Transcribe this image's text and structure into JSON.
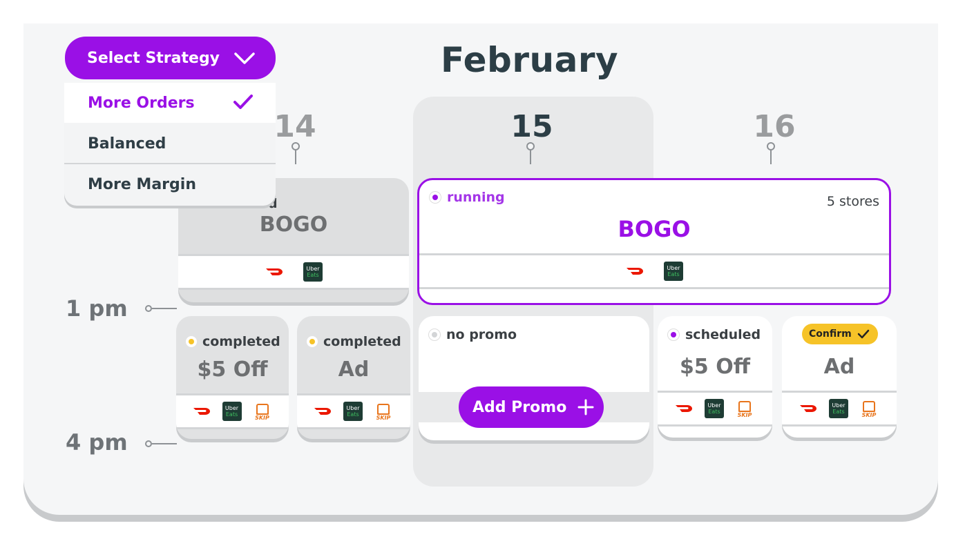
{
  "header": {
    "month": "February"
  },
  "days": [
    "14",
    "15",
    "16"
  ],
  "times": [
    "1 pm",
    "4 pm"
  ],
  "strategy": {
    "button_label": "Select Strategy",
    "options": [
      {
        "label": "More Orders",
        "selected": true
      },
      {
        "label": "Balanced",
        "selected": false
      },
      {
        "label": "More Margin",
        "selected": false
      }
    ]
  },
  "cards": {
    "d14_top": {
      "status_visible": "d",
      "name": "BOGO"
    },
    "d15_top": {
      "status": "running",
      "stores": "5 stores",
      "name": "BOGO"
    },
    "d14_a": {
      "status": "completed",
      "name": "$5 Off"
    },
    "d14_b": {
      "status": "completed",
      "name": "Ad"
    },
    "d15_mid": {
      "status": "no promo",
      "add_label": "Add Promo"
    },
    "d16_a": {
      "status": "scheduled",
      "name": "$5 Off"
    },
    "d16_b": {
      "confirm_label": "Confirm",
      "name": "Ad"
    }
  },
  "logos": {
    "uber_line1": "Uber",
    "uber_line2": "Eats",
    "skip_text": "SKIP"
  },
  "colors": {
    "accent": "#9a10e6",
    "completed": "#f6c328",
    "running": "#9a10e6",
    "no_promo": "#d3d5d7"
  }
}
